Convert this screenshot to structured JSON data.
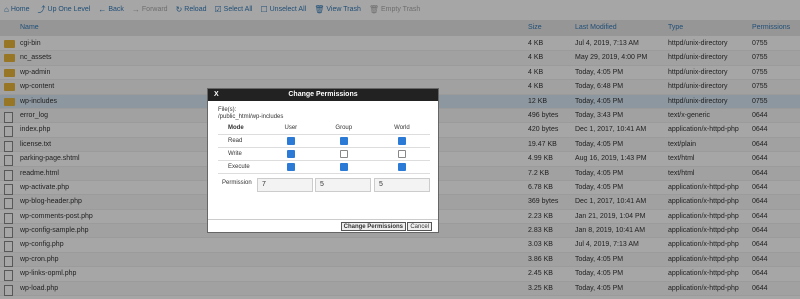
{
  "toolbar": {
    "items": [
      {
        "label": "Home",
        "icon": "home-icon"
      },
      {
        "label": "Up One Level",
        "icon": "up-level-icon"
      },
      {
        "label": "Back",
        "icon": "back-icon"
      },
      {
        "label": "Forward",
        "icon": "forward-icon",
        "disabled": true
      },
      {
        "label": "Reload",
        "icon": "reload-icon"
      },
      {
        "label": "Select All",
        "icon": "select-all-icon"
      },
      {
        "label": "Unselect All",
        "icon": "unselect-all-icon"
      },
      {
        "label": "View Trash",
        "icon": "trash-icon"
      },
      {
        "label": "Empty Trash",
        "icon": "empty-trash-icon",
        "disabled": true
      }
    ]
  },
  "table": {
    "headers": {
      "name": "Name",
      "size": "Size",
      "modified": "Last Modified",
      "type": "Type",
      "perms": "Permissions"
    },
    "rows": [
      {
        "name": "cgi-bin",
        "size": "4 KB",
        "modified": "Jul 4, 2019, 7:13 AM",
        "type": "httpd/unix-directory",
        "perms": "0755",
        "kind": "folder"
      },
      {
        "name": "nc_assets",
        "size": "4 KB",
        "modified": "May 29, 2019, 4:00 PM",
        "type": "httpd/unix-directory",
        "perms": "0755",
        "kind": "folder"
      },
      {
        "name": "wp-admin",
        "size": "4 KB",
        "modified": "Today, 4:05 PM",
        "type": "httpd/unix-directory",
        "perms": "0755",
        "kind": "folder"
      },
      {
        "name": "wp-content",
        "size": "4 KB",
        "modified": "Today, 6:48 PM",
        "type": "httpd/unix-directory",
        "perms": "0755",
        "kind": "folder"
      },
      {
        "name": "wp-includes",
        "size": "12 KB",
        "modified": "Today, 4:05 PM",
        "type": "httpd/unix-directory",
        "perms": "0755",
        "kind": "folder",
        "selected": true
      },
      {
        "name": "error_log",
        "size": "496 bytes",
        "modified": "Today, 3:43 PM",
        "type": "text/x-generic",
        "perms": "0644",
        "kind": "file"
      },
      {
        "name": "index.php",
        "size": "420 bytes",
        "modified": "Dec 1, 2017, 10:41 AM",
        "type": "application/x-httpd-php",
        "perms": "0644",
        "kind": "file"
      },
      {
        "name": "license.txt",
        "size": "19.47 KB",
        "modified": "Today, 4:05 PM",
        "type": "text/plain",
        "perms": "0644",
        "kind": "file"
      },
      {
        "name": "parking-page.shtml",
        "size": "4.99 KB",
        "modified": "Aug 16, 2019, 1:43 PM",
        "type": "text/html",
        "perms": "0644",
        "kind": "file"
      },
      {
        "name": "readme.html",
        "size": "7.2 KB",
        "modified": "Today, 4:05 PM",
        "type": "text/html",
        "perms": "0644",
        "kind": "file"
      },
      {
        "name": "wp-activate.php",
        "size": "6.78 KB",
        "modified": "Today, 4:05 PM",
        "type": "application/x-httpd-php",
        "perms": "0644",
        "kind": "file"
      },
      {
        "name": "wp-blog-header.php",
        "size": "369 bytes",
        "modified": "Dec 1, 2017, 10:41 AM",
        "type": "application/x-httpd-php",
        "perms": "0644",
        "kind": "file"
      },
      {
        "name": "wp-comments-post.php",
        "size": "2.23 KB",
        "modified": "Jan 21, 2019, 1:04 PM",
        "type": "application/x-httpd-php",
        "perms": "0644",
        "kind": "file"
      },
      {
        "name": "wp-config-sample.php",
        "size": "2.83 KB",
        "modified": "Jan 8, 2019, 10:41 AM",
        "type": "application/x-httpd-php",
        "perms": "0644",
        "kind": "file"
      },
      {
        "name": "wp-config.php",
        "size": "3.03 KB",
        "modified": "Jul 4, 2019, 7:13 AM",
        "type": "application/x-httpd-php",
        "perms": "0644",
        "kind": "file"
      },
      {
        "name": "wp-cron.php",
        "size": "3.86 KB",
        "modified": "Today, 4:05 PM",
        "type": "application/x-httpd-php",
        "perms": "0644",
        "kind": "file"
      },
      {
        "name": "wp-links-opml.php",
        "size": "2.45 KB",
        "modified": "Today, 4:05 PM",
        "type": "application/x-httpd-php",
        "perms": "0644",
        "kind": "file"
      },
      {
        "name": "wp-load.php",
        "size": "3.25 KB",
        "modified": "Today, 4:05 PM",
        "type": "application/x-httpd-php",
        "perms": "0644",
        "kind": "file"
      }
    ]
  },
  "modal": {
    "title": "Change Permissions",
    "close_label": "X",
    "files_label": "File(s):",
    "files_path": "/public_html/wp-includes",
    "columns": {
      "mode": "Mode",
      "user": "User",
      "group": "Group",
      "world": "World"
    },
    "rows": [
      {
        "label": "Read",
        "user": true,
        "group": true,
        "world": true
      },
      {
        "label": "Write",
        "user": true,
        "group": false,
        "world": false
      },
      {
        "label": "Execute",
        "user": true,
        "group": true,
        "world": true
      }
    ],
    "permission_label": "Permission",
    "permission_values": {
      "user": "7",
      "group": "5",
      "world": "5"
    },
    "change_button": "Change Permissions",
    "cancel_button": "Cancel"
  }
}
